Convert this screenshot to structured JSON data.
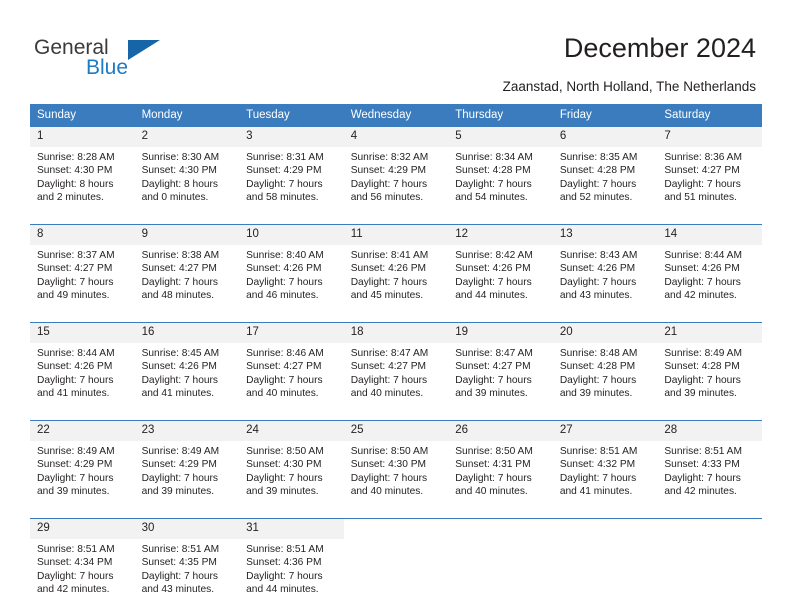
{
  "brand": {
    "name_top": "General",
    "name_bottom": "Blue",
    "color_dark": "#3b3b3b",
    "color_blue": "#1f7ac4",
    "triangle_icon": "triangle-icon"
  },
  "header": {
    "title": "December 2024",
    "subtitle": "Zaanstad, North Holland, The Netherlands"
  },
  "theme": {
    "header_bg": "#3a7cbe",
    "header_text": "#ffffff",
    "daynum_bg": "#f2f2f2",
    "body_text": "#231f20",
    "separator": "#3a7cbe"
  },
  "calendar": {
    "weekday_headers": [
      "Sunday",
      "Monday",
      "Tuesday",
      "Wednesday",
      "Thursday",
      "Friday",
      "Saturday"
    ],
    "weeks": [
      [
        {
          "day": "1",
          "sunrise": "Sunrise: 8:28 AM",
          "sunset": "Sunset: 4:30 PM",
          "daylight1": "Daylight: 8 hours",
          "daylight2": "and 2 minutes."
        },
        {
          "day": "2",
          "sunrise": "Sunrise: 8:30 AM",
          "sunset": "Sunset: 4:30 PM",
          "daylight1": "Daylight: 8 hours",
          "daylight2": "and 0 minutes."
        },
        {
          "day": "3",
          "sunrise": "Sunrise: 8:31 AM",
          "sunset": "Sunset: 4:29 PM",
          "daylight1": "Daylight: 7 hours",
          "daylight2": "and 58 minutes."
        },
        {
          "day": "4",
          "sunrise": "Sunrise: 8:32 AM",
          "sunset": "Sunset: 4:29 PM",
          "daylight1": "Daylight: 7 hours",
          "daylight2": "and 56 minutes."
        },
        {
          "day": "5",
          "sunrise": "Sunrise: 8:34 AM",
          "sunset": "Sunset: 4:28 PM",
          "daylight1": "Daylight: 7 hours",
          "daylight2": "and 54 minutes."
        },
        {
          "day": "6",
          "sunrise": "Sunrise: 8:35 AM",
          "sunset": "Sunset: 4:28 PM",
          "daylight1": "Daylight: 7 hours",
          "daylight2": "and 52 minutes."
        },
        {
          "day": "7",
          "sunrise": "Sunrise: 8:36 AM",
          "sunset": "Sunset: 4:27 PM",
          "daylight1": "Daylight: 7 hours",
          "daylight2": "and 51 minutes."
        }
      ],
      [
        {
          "day": "8",
          "sunrise": "Sunrise: 8:37 AM",
          "sunset": "Sunset: 4:27 PM",
          "daylight1": "Daylight: 7 hours",
          "daylight2": "and 49 minutes."
        },
        {
          "day": "9",
          "sunrise": "Sunrise: 8:38 AM",
          "sunset": "Sunset: 4:27 PM",
          "daylight1": "Daylight: 7 hours",
          "daylight2": "and 48 minutes."
        },
        {
          "day": "10",
          "sunrise": "Sunrise: 8:40 AM",
          "sunset": "Sunset: 4:26 PM",
          "daylight1": "Daylight: 7 hours",
          "daylight2": "and 46 minutes."
        },
        {
          "day": "11",
          "sunrise": "Sunrise: 8:41 AM",
          "sunset": "Sunset: 4:26 PM",
          "daylight1": "Daylight: 7 hours",
          "daylight2": "and 45 minutes."
        },
        {
          "day": "12",
          "sunrise": "Sunrise: 8:42 AM",
          "sunset": "Sunset: 4:26 PM",
          "daylight1": "Daylight: 7 hours",
          "daylight2": "and 44 minutes."
        },
        {
          "day": "13",
          "sunrise": "Sunrise: 8:43 AM",
          "sunset": "Sunset: 4:26 PM",
          "daylight1": "Daylight: 7 hours",
          "daylight2": "and 43 minutes."
        },
        {
          "day": "14",
          "sunrise": "Sunrise: 8:44 AM",
          "sunset": "Sunset: 4:26 PM",
          "daylight1": "Daylight: 7 hours",
          "daylight2": "and 42 minutes."
        }
      ],
      [
        {
          "day": "15",
          "sunrise": "Sunrise: 8:44 AM",
          "sunset": "Sunset: 4:26 PM",
          "daylight1": "Daylight: 7 hours",
          "daylight2": "and 41 minutes."
        },
        {
          "day": "16",
          "sunrise": "Sunrise: 8:45 AM",
          "sunset": "Sunset: 4:26 PM",
          "daylight1": "Daylight: 7 hours",
          "daylight2": "and 41 minutes."
        },
        {
          "day": "17",
          "sunrise": "Sunrise: 8:46 AM",
          "sunset": "Sunset: 4:27 PM",
          "daylight1": "Daylight: 7 hours",
          "daylight2": "and 40 minutes."
        },
        {
          "day": "18",
          "sunrise": "Sunrise: 8:47 AM",
          "sunset": "Sunset: 4:27 PM",
          "daylight1": "Daylight: 7 hours",
          "daylight2": "and 40 minutes."
        },
        {
          "day": "19",
          "sunrise": "Sunrise: 8:47 AM",
          "sunset": "Sunset: 4:27 PM",
          "daylight1": "Daylight: 7 hours",
          "daylight2": "and 39 minutes."
        },
        {
          "day": "20",
          "sunrise": "Sunrise: 8:48 AM",
          "sunset": "Sunset: 4:28 PM",
          "daylight1": "Daylight: 7 hours",
          "daylight2": "and 39 minutes."
        },
        {
          "day": "21",
          "sunrise": "Sunrise: 8:49 AM",
          "sunset": "Sunset: 4:28 PM",
          "daylight1": "Daylight: 7 hours",
          "daylight2": "and 39 minutes."
        }
      ],
      [
        {
          "day": "22",
          "sunrise": "Sunrise: 8:49 AM",
          "sunset": "Sunset: 4:29 PM",
          "daylight1": "Daylight: 7 hours",
          "daylight2": "and 39 minutes."
        },
        {
          "day": "23",
          "sunrise": "Sunrise: 8:49 AM",
          "sunset": "Sunset: 4:29 PM",
          "daylight1": "Daylight: 7 hours",
          "daylight2": "and 39 minutes."
        },
        {
          "day": "24",
          "sunrise": "Sunrise: 8:50 AM",
          "sunset": "Sunset: 4:30 PM",
          "daylight1": "Daylight: 7 hours",
          "daylight2": "and 39 minutes."
        },
        {
          "day": "25",
          "sunrise": "Sunrise: 8:50 AM",
          "sunset": "Sunset: 4:30 PM",
          "daylight1": "Daylight: 7 hours",
          "daylight2": "and 40 minutes."
        },
        {
          "day": "26",
          "sunrise": "Sunrise: 8:50 AM",
          "sunset": "Sunset: 4:31 PM",
          "daylight1": "Daylight: 7 hours",
          "daylight2": "and 40 minutes."
        },
        {
          "day": "27",
          "sunrise": "Sunrise: 8:51 AM",
          "sunset": "Sunset: 4:32 PM",
          "daylight1": "Daylight: 7 hours",
          "daylight2": "and 41 minutes."
        },
        {
          "day": "28",
          "sunrise": "Sunrise: 8:51 AM",
          "sunset": "Sunset: 4:33 PM",
          "daylight1": "Daylight: 7 hours",
          "daylight2": "and 42 minutes."
        }
      ],
      [
        {
          "day": "29",
          "sunrise": "Sunrise: 8:51 AM",
          "sunset": "Sunset: 4:34 PM",
          "daylight1": "Daylight: 7 hours",
          "daylight2": "and 42 minutes."
        },
        {
          "day": "30",
          "sunrise": "Sunrise: 8:51 AM",
          "sunset": "Sunset: 4:35 PM",
          "daylight1": "Daylight: 7 hours",
          "daylight2": "and 43 minutes."
        },
        {
          "day": "31",
          "sunrise": "Sunrise: 8:51 AM",
          "sunset": "Sunset: 4:36 PM",
          "daylight1": "Daylight: 7 hours",
          "daylight2": "and 44 minutes."
        },
        {
          "day": "",
          "sunrise": "",
          "sunset": "",
          "daylight1": "",
          "daylight2": ""
        },
        {
          "day": "",
          "sunrise": "",
          "sunset": "",
          "daylight1": "",
          "daylight2": ""
        },
        {
          "day": "",
          "sunrise": "",
          "sunset": "",
          "daylight1": "",
          "daylight2": ""
        },
        {
          "day": "",
          "sunrise": "",
          "sunset": "",
          "daylight1": "",
          "daylight2": ""
        }
      ]
    ]
  }
}
